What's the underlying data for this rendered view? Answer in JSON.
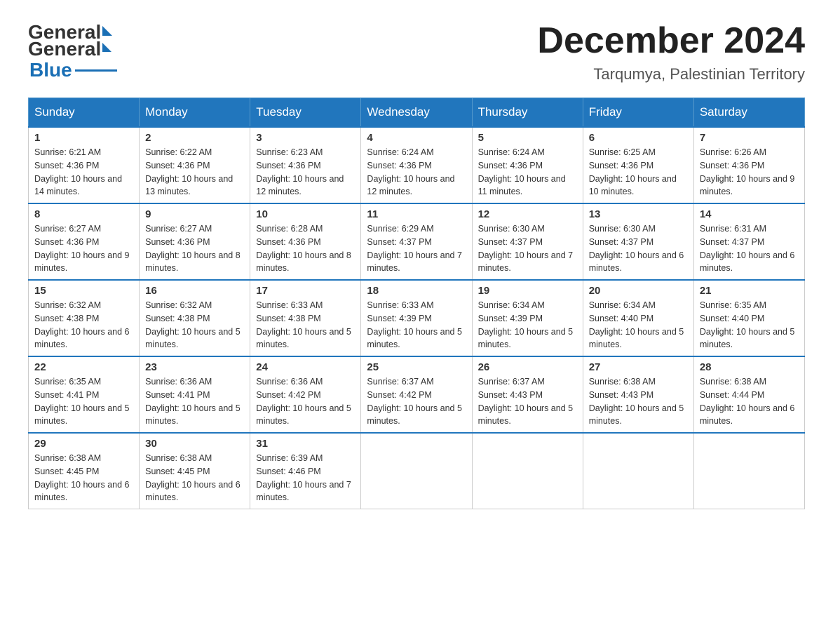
{
  "header": {
    "logo_general": "General",
    "logo_blue": "Blue",
    "title": "December 2024",
    "location": "Tarqumya, Palestinian Territory"
  },
  "weekdays": [
    "Sunday",
    "Monday",
    "Tuesday",
    "Wednesday",
    "Thursday",
    "Friday",
    "Saturday"
  ],
  "weeks": [
    [
      {
        "day": "1",
        "sunrise": "6:21 AM",
        "sunset": "4:36 PM",
        "daylight": "10 hours and 14 minutes."
      },
      {
        "day": "2",
        "sunrise": "6:22 AM",
        "sunset": "4:36 PM",
        "daylight": "10 hours and 13 minutes."
      },
      {
        "day": "3",
        "sunrise": "6:23 AM",
        "sunset": "4:36 PM",
        "daylight": "10 hours and 12 minutes."
      },
      {
        "day": "4",
        "sunrise": "6:24 AM",
        "sunset": "4:36 PM",
        "daylight": "10 hours and 12 minutes."
      },
      {
        "day": "5",
        "sunrise": "6:24 AM",
        "sunset": "4:36 PM",
        "daylight": "10 hours and 11 minutes."
      },
      {
        "day": "6",
        "sunrise": "6:25 AM",
        "sunset": "4:36 PM",
        "daylight": "10 hours and 10 minutes."
      },
      {
        "day": "7",
        "sunrise": "6:26 AM",
        "sunset": "4:36 PM",
        "daylight": "10 hours and 9 minutes."
      }
    ],
    [
      {
        "day": "8",
        "sunrise": "6:27 AM",
        "sunset": "4:36 PM",
        "daylight": "10 hours and 9 minutes."
      },
      {
        "day": "9",
        "sunrise": "6:27 AM",
        "sunset": "4:36 PM",
        "daylight": "10 hours and 8 minutes."
      },
      {
        "day": "10",
        "sunrise": "6:28 AM",
        "sunset": "4:36 PM",
        "daylight": "10 hours and 8 minutes."
      },
      {
        "day": "11",
        "sunrise": "6:29 AM",
        "sunset": "4:37 PM",
        "daylight": "10 hours and 7 minutes."
      },
      {
        "day": "12",
        "sunrise": "6:30 AM",
        "sunset": "4:37 PM",
        "daylight": "10 hours and 7 minutes."
      },
      {
        "day": "13",
        "sunrise": "6:30 AM",
        "sunset": "4:37 PM",
        "daylight": "10 hours and 6 minutes."
      },
      {
        "day": "14",
        "sunrise": "6:31 AM",
        "sunset": "4:37 PM",
        "daylight": "10 hours and 6 minutes."
      }
    ],
    [
      {
        "day": "15",
        "sunrise": "6:32 AM",
        "sunset": "4:38 PM",
        "daylight": "10 hours and 6 minutes."
      },
      {
        "day": "16",
        "sunrise": "6:32 AM",
        "sunset": "4:38 PM",
        "daylight": "10 hours and 5 minutes."
      },
      {
        "day": "17",
        "sunrise": "6:33 AM",
        "sunset": "4:38 PM",
        "daylight": "10 hours and 5 minutes."
      },
      {
        "day": "18",
        "sunrise": "6:33 AM",
        "sunset": "4:39 PM",
        "daylight": "10 hours and 5 minutes."
      },
      {
        "day": "19",
        "sunrise": "6:34 AM",
        "sunset": "4:39 PM",
        "daylight": "10 hours and 5 minutes."
      },
      {
        "day": "20",
        "sunrise": "6:34 AM",
        "sunset": "4:40 PM",
        "daylight": "10 hours and 5 minutes."
      },
      {
        "day": "21",
        "sunrise": "6:35 AM",
        "sunset": "4:40 PM",
        "daylight": "10 hours and 5 minutes."
      }
    ],
    [
      {
        "day": "22",
        "sunrise": "6:35 AM",
        "sunset": "4:41 PM",
        "daylight": "10 hours and 5 minutes."
      },
      {
        "day": "23",
        "sunrise": "6:36 AM",
        "sunset": "4:41 PM",
        "daylight": "10 hours and 5 minutes."
      },
      {
        "day": "24",
        "sunrise": "6:36 AM",
        "sunset": "4:42 PM",
        "daylight": "10 hours and 5 minutes."
      },
      {
        "day": "25",
        "sunrise": "6:37 AM",
        "sunset": "4:42 PM",
        "daylight": "10 hours and 5 minutes."
      },
      {
        "day": "26",
        "sunrise": "6:37 AM",
        "sunset": "4:43 PM",
        "daylight": "10 hours and 5 minutes."
      },
      {
        "day": "27",
        "sunrise": "6:38 AM",
        "sunset": "4:43 PM",
        "daylight": "10 hours and 5 minutes."
      },
      {
        "day": "28",
        "sunrise": "6:38 AM",
        "sunset": "4:44 PM",
        "daylight": "10 hours and 6 minutes."
      }
    ],
    [
      {
        "day": "29",
        "sunrise": "6:38 AM",
        "sunset": "4:45 PM",
        "daylight": "10 hours and 6 minutes."
      },
      {
        "day": "30",
        "sunrise": "6:38 AM",
        "sunset": "4:45 PM",
        "daylight": "10 hours and 6 minutes."
      },
      {
        "day": "31",
        "sunrise": "6:39 AM",
        "sunset": "4:46 PM",
        "daylight": "10 hours and 7 minutes."
      },
      null,
      null,
      null,
      null
    ]
  ]
}
